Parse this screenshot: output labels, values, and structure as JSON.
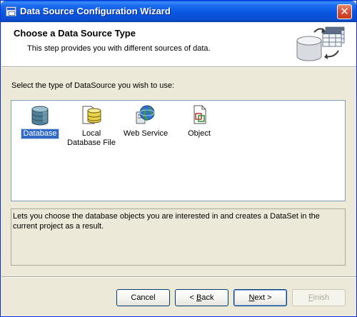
{
  "window": {
    "title": "Data Source Configuration Wizard",
    "close_glyph": "✕"
  },
  "header": {
    "title": "Choose a Data Source Type",
    "subtitle": "This step provides you with different sources of data."
  },
  "prompt": "Select the type of DataSource you wish to use:",
  "sources": [
    {
      "label": "Database",
      "icon": "database-icon",
      "selected": true
    },
    {
      "label": "Local Database File",
      "icon": "local-database-file-icon",
      "selected": false
    },
    {
      "label": "Web Service",
      "icon": "web-service-globe-icon",
      "selected": false
    },
    {
      "label": "Object",
      "icon": "object-icon",
      "selected": false
    }
  ],
  "description": "Lets you choose the database objects you are interested in and creates a DataSet in the current project as a result.",
  "buttons": {
    "cancel": "Cancel",
    "back_prefix": "< ",
    "back_accel": "B",
    "back_rest": "ack",
    "next_accel": "N",
    "next_rest": "ext >",
    "finish_accel": "F",
    "finish_rest": "inish"
  },
  "colors": {
    "titlebar": "#0a56e0",
    "selection": "#316ac5",
    "window_bg": "#ece9d8"
  }
}
